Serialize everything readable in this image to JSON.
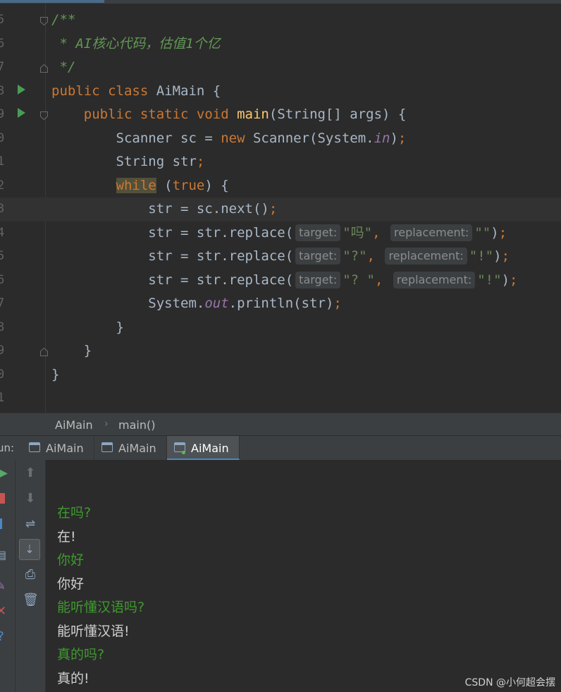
{
  "editor": {
    "lines": [
      {
        "num": "5",
        "tokens": [
          {
            "t": "/**",
            "c": "doc"
          }
        ]
      },
      {
        "num": "6",
        "tokens": [
          {
            "t": " * ",
            "c": "doc"
          },
          {
            "t": "AI核心代码，估值1个亿",
            "c": "doc"
          }
        ]
      },
      {
        "num": "7",
        "tokens": [
          {
            "t": " */",
            "c": "doc"
          }
        ]
      },
      {
        "num": "8",
        "tokens": [
          {
            "t": "public class ",
            "c": "kw"
          },
          {
            "t": "AiMain {",
            "c": ""
          }
        ]
      },
      {
        "num": "9",
        "tokens": [
          {
            "t": "    public static void ",
            "c": "kw"
          },
          {
            "t": "main",
            "c": "fn"
          },
          {
            "t": "(String[] args) {",
            "c": ""
          }
        ]
      },
      {
        "num": "0",
        "tokens": [
          {
            "t": "        Scanner sc = ",
            "c": ""
          },
          {
            "t": "new ",
            "c": "kw"
          },
          {
            "t": "Scanner(System.",
            "c": ""
          },
          {
            "t": "in",
            "c": "stat"
          },
          {
            "t": ")",
            "c": ""
          },
          {
            "t": ";",
            "c": "kw"
          }
        ]
      },
      {
        "num": "1",
        "tokens": [
          {
            "t": "        String str",
            "c": ""
          },
          {
            "t": ";",
            "c": "kw"
          }
        ]
      },
      {
        "num": "2",
        "tokens": [
          {
            "t": "        ",
            "c": ""
          },
          {
            "t": "while",
            "c": "kw hl-while"
          },
          {
            "t": " (",
            "c": ""
          },
          {
            "t": "true",
            "c": "kw"
          },
          {
            "t": ") {",
            "c": ""
          }
        ]
      },
      {
        "num": "3",
        "current": true,
        "tokens": [
          {
            "t": "            str = sc.next()",
            "c": ""
          },
          {
            "t": ";",
            "c": "kw"
          }
        ]
      },
      {
        "num": "4",
        "tokens": [
          {
            "t": "            str = str.replace(",
            "c": ""
          },
          {
            "t": "target:",
            "c": "hint"
          },
          {
            "t": "\"吗\"",
            "c": "str"
          },
          {
            "t": ", ",
            "c": "kw"
          },
          {
            "t": "replacement:",
            "c": "hint"
          },
          {
            "t": "\"\"",
            "c": "str"
          },
          {
            "t": ")",
            "c": ""
          },
          {
            "t": ";",
            "c": "kw"
          }
        ]
      },
      {
        "num": "5",
        "tokens": [
          {
            "t": "            str = str.replace(",
            "c": ""
          },
          {
            "t": "target:",
            "c": "hint"
          },
          {
            "t": "\"?\"",
            "c": "str"
          },
          {
            "t": ", ",
            "c": "kw"
          },
          {
            "t": "replacement:",
            "c": "hint"
          },
          {
            "t": "\"!\"",
            "c": "str"
          },
          {
            "t": ")",
            "c": ""
          },
          {
            "t": ";",
            "c": "kw"
          }
        ]
      },
      {
        "num": "6",
        "tokens": [
          {
            "t": "            str = str.replace(",
            "c": ""
          },
          {
            "t": "target:",
            "c": "hint"
          },
          {
            "t": "\"? \"",
            "c": "str"
          },
          {
            "t": ", ",
            "c": "kw"
          },
          {
            "t": "replacement:",
            "c": "hint"
          },
          {
            "t": "\"!\"",
            "c": "str"
          },
          {
            "t": ")",
            "c": ""
          },
          {
            "t": ";",
            "c": "kw"
          }
        ]
      },
      {
        "num": "7",
        "tokens": [
          {
            "t": "            System.",
            "c": ""
          },
          {
            "t": "out",
            "c": "stat"
          },
          {
            "t": ".println(str)",
            "c": ""
          },
          {
            "t": ";",
            "c": "kw"
          }
        ]
      },
      {
        "num": "8",
        "tokens": [
          {
            "t": "        }",
            "c": ""
          }
        ]
      },
      {
        "num": "9",
        "tokens": [
          {
            "t": "    }",
            "c": ""
          }
        ]
      },
      {
        "num": "0",
        "tokens": [
          {
            "t": "}",
            "c": ""
          }
        ]
      },
      {
        "num": "1",
        "tokens": []
      }
    ]
  },
  "breadcrumb": {
    "class_name": "AiMain",
    "separator": "›",
    "method_name": "main()"
  },
  "run_panel": {
    "label": "un:",
    "tabs": [
      {
        "label": "AiMain",
        "active": false
      },
      {
        "label": "AiMain",
        "active": false
      },
      {
        "label": "AiMain",
        "active": true
      }
    ]
  },
  "console": {
    "lines": [
      {
        "text": "在吗?",
        "kind": "input"
      },
      {
        "text": "在!",
        "kind": "output"
      },
      {
        "text": "你好",
        "kind": "input"
      },
      {
        "text": "你好",
        "kind": "output"
      },
      {
        "text": "能听懂汉语吗?",
        "kind": "input"
      },
      {
        "text": "能听懂汉语!",
        "kind": "output"
      },
      {
        "text": "真的吗?",
        "kind": "input"
      },
      {
        "text": "真的!",
        "kind": "output"
      }
    ]
  },
  "watermark": "CSDN @小何超会摆",
  "colors": {
    "keyword": "#cc7832",
    "string": "#6a8759",
    "method": "#ffc66d",
    "static_field": "#9876aa",
    "console_input": "#3f9a2f"
  },
  "icons": [
    "run-icon",
    "stop-icon",
    "rerun-icon",
    "up-arrow-icon",
    "down-arrow-icon",
    "soft-wrap-icon",
    "scroll-to-end-icon",
    "print-icon",
    "trash-icon",
    "fold-icon"
  ]
}
